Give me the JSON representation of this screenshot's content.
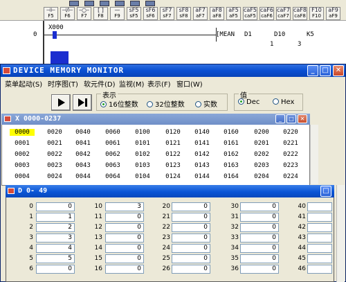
{
  "toolbar": {
    "fkeys": [
      {
        "glyph": "⊣⊢",
        "label": "F5"
      },
      {
        "glyph": "⊣/⊢",
        "label": "F6"
      },
      {
        "glyph": "–○–",
        "label": "F7"
      },
      {
        "glyph": "[ ]",
        "label": "F8"
      },
      {
        "glyph": "—",
        "label": "F9"
      },
      {
        "glyph": "sF5",
        "label": "sF5"
      },
      {
        "glyph": "sF6",
        "label": "sF6"
      },
      {
        "glyph": "sF7",
        "label": "sF7"
      },
      {
        "glyph": "sF8",
        "label": "sF8"
      },
      {
        "glyph": "aF7",
        "label": "aF7"
      },
      {
        "glyph": "aF8",
        "label": "aF8"
      },
      {
        "glyph": "aF5",
        "label": "aF5"
      },
      {
        "glyph": "caF5",
        "label": "caF5"
      },
      {
        "glyph": "caF6",
        "label": "caF6"
      },
      {
        "glyph": "caF7",
        "label": "caF7"
      },
      {
        "glyph": "caF8",
        "label": "caF8"
      },
      {
        "glyph": "F10",
        "label": "F10"
      },
      {
        "glyph": "aF9",
        "label": "aF9"
      }
    ]
  },
  "ladder": {
    "step": "0",
    "contact": "X000",
    "instruction": "[MEAN",
    "operands": [
      "D1",
      "D10",
      "K5"
    ],
    "values": [
      "1",
      "3"
    ]
  },
  "window": {
    "title": "DEVICE MEMORY MONITOR",
    "menus": [
      "菜单起动(S)",
      "时序图(T)",
      "软元件(D)",
      "监视(M)",
      "表示(F)",
      "窗口(W)"
    ],
    "display_group": {
      "label": "表示",
      "options": [
        "16位整数",
        "32位整数",
        "实数"
      ],
      "selected": 0
    },
    "value_group": {
      "label": "值",
      "options": [
        "Dec",
        "Hex"
      ],
      "selected": 0
    }
  },
  "x_window": {
    "title": "X   0000-0237",
    "rows": [
      [
        "0000",
        "0020",
        "0040",
        "0060",
        "0100",
        "0120",
        "0140",
        "0160",
        "0200",
        "0220"
      ],
      [
        "0001",
        "0021",
        "0041",
        "0061",
        "0101",
        "0121",
        "0141",
        "0161",
        "0201",
        "0221"
      ],
      [
        "0002",
        "0022",
        "0042",
        "0062",
        "0102",
        "0122",
        "0142",
        "0162",
        "0202",
        "0222"
      ],
      [
        "0003",
        "0023",
        "0043",
        "0063",
        "0103",
        "0123",
        "0143",
        "0163",
        "0203",
        "0223"
      ],
      [
        "0004",
        "0024",
        "0044",
        "0064",
        "0104",
        "0124",
        "0144",
        "0164",
        "0204",
        "0224"
      ]
    ]
  },
  "d_window": {
    "title": "D   0-  49",
    "columns": [
      [
        {
          "addr": "0",
          "value": "0"
        },
        {
          "addr": "1",
          "value": "1"
        },
        {
          "addr": "2",
          "value": "2"
        },
        {
          "addr": "3",
          "value": "3"
        },
        {
          "addr": "4",
          "value": "4"
        },
        {
          "addr": "5",
          "value": "5"
        },
        {
          "addr": "6",
          "value": "0"
        }
      ],
      [
        {
          "addr": "10",
          "value": "3"
        },
        {
          "addr": "11",
          "value": "0"
        },
        {
          "addr": "12",
          "value": "0"
        },
        {
          "addr": "13",
          "value": "0"
        },
        {
          "addr": "14",
          "value": "0"
        },
        {
          "addr": "15",
          "value": "0"
        },
        {
          "addr": "16",
          "value": "0"
        }
      ],
      [
        {
          "addr": "20",
          "value": "0"
        },
        {
          "addr": "21",
          "value": "0"
        },
        {
          "addr": "22",
          "value": "0"
        },
        {
          "addr": "23",
          "value": "0"
        },
        {
          "addr": "24",
          "value": "0"
        },
        {
          "addr": "25",
          "value": "0"
        },
        {
          "addr": "26",
          "value": "0"
        }
      ],
      [
        {
          "addr": "30",
          "value": "0"
        },
        {
          "addr": "31",
          "value": "0"
        },
        {
          "addr": "32",
          "value": "0"
        },
        {
          "addr": "33",
          "value": "0"
        },
        {
          "addr": "34",
          "value": "0"
        },
        {
          "addr": "35",
          "value": "0"
        },
        {
          "addr": "36",
          "value": "0"
        }
      ],
      [
        {
          "addr": "40",
          "value": ""
        },
        {
          "addr": "41",
          "value": ""
        },
        {
          "addr": "42",
          "value": ""
        },
        {
          "addr": "43",
          "value": ""
        },
        {
          "addr": "44",
          "value": ""
        },
        {
          "addr": "45",
          "value": ""
        },
        {
          "addr": "46",
          "value": ""
        }
      ]
    ]
  }
}
